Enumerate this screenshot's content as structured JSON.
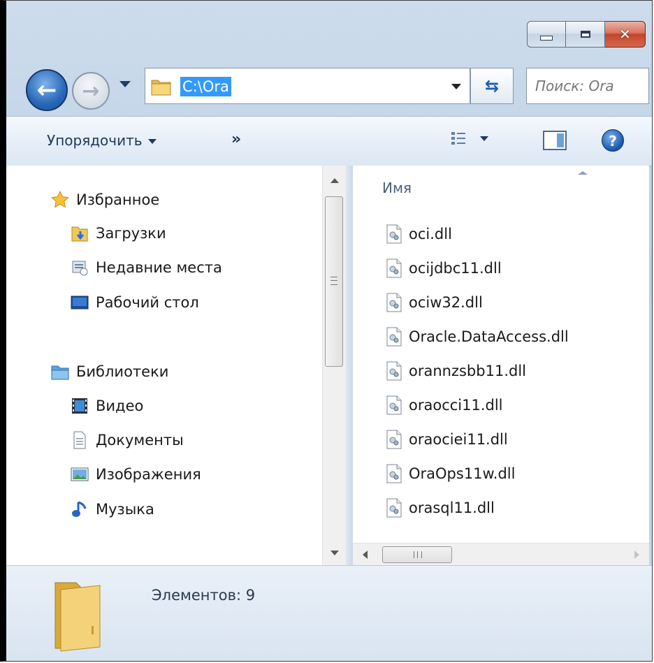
{
  "window": {
    "controls": {
      "minimize_icon": "minimize-icon",
      "maximize_icon": "maximize-icon",
      "close_label": "✕"
    }
  },
  "nav": {
    "back_icon": "back-arrow-icon",
    "back_glyph": "←",
    "forward_glyph": "→",
    "address": "C:\\Ora",
    "refresh_glyph": "⇆",
    "search_placeholder": "Поиск: Ora"
  },
  "toolbar": {
    "organize_label": "Упорядочить",
    "more_label": "»",
    "help_label": "?"
  },
  "sidebar": {
    "groups": [
      {
        "label": "Избранное",
        "icon": "star-icon",
        "items": [
          {
            "label": "Загрузки",
            "icon": "downloads-icon"
          },
          {
            "label": "Недавние места",
            "icon": "recent-places-icon"
          },
          {
            "label": "Рабочий стол",
            "icon": "desktop-icon"
          }
        ]
      },
      {
        "label": "Библиотеки",
        "icon": "libraries-icon",
        "items": [
          {
            "label": "Видео",
            "icon": "video-icon"
          },
          {
            "label": "Документы",
            "icon": "documents-icon"
          },
          {
            "label": "Изображения",
            "icon": "pictures-icon"
          },
          {
            "label": "Музыка",
            "icon": "music-icon"
          }
        ]
      }
    ]
  },
  "files": {
    "column_header": "Имя",
    "items": [
      "oci.dll",
      "ocijdbc11.dll",
      "ociw32.dll",
      "Oracle.DataAccess.dll",
      "orannzsbb11.dll",
      "oraocci11.dll",
      "oraociei11.dll",
      "OraOps11w.dll",
      "orasql11.dll"
    ]
  },
  "status": {
    "count_text": "Элементов: 9"
  }
}
